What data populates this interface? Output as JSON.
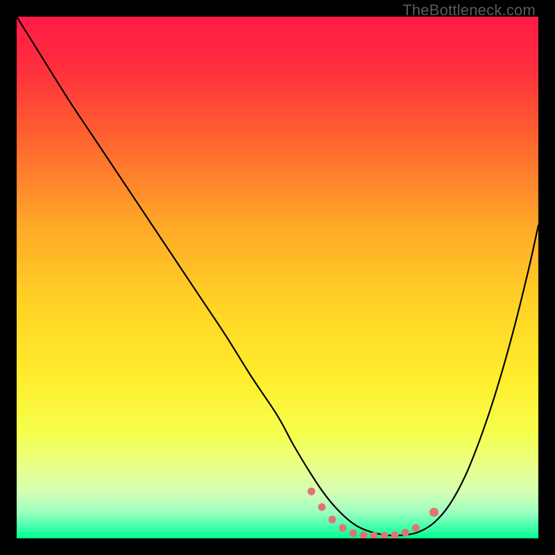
{
  "watermark": "TheBottleneck.com",
  "colors": {
    "frame_bg": "#000000",
    "curve": "#000000",
    "marker_fill": "#e17372",
    "marker_stroke": "#d85f5e"
  },
  "chart_data": {
    "type": "line",
    "title": "",
    "xlabel": "",
    "ylabel": "",
    "xlim": [
      0,
      100
    ],
    "ylim": [
      0,
      100
    ],
    "gradient_stops": [
      {
        "offset": 0.0,
        "color": "#ff1a47"
      },
      {
        "offset": 0.1,
        "color": "#ff2f3d"
      },
      {
        "offset": 0.25,
        "color": "#ff6a2f"
      },
      {
        "offset": 0.4,
        "color": "#ffa828"
      },
      {
        "offset": 0.55,
        "color": "#ffd325"
      },
      {
        "offset": 0.7,
        "color": "#ffee2e"
      },
      {
        "offset": 0.8,
        "color": "#f6ff4e"
      },
      {
        "offset": 0.86,
        "color": "#eaff88"
      },
      {
        "offset": 0.91,
        "color": "#d6ffb3"
      },
      {
        "offset": 0.95,
        "color": "#9cffc0"
      },
      {
        "offset": 0.975,
        "color": "#4dffad"
      },
      {
        "offset": 1.0,
        "color": "#00ff90"
      }
    ],
    "series": [
      {
        "name": "bottleneck-curve",
        "x": [
          0,
          5,
          10,
          15,
          20,
          25,
          30,
          35,
          40,
          45,
          50,
          53,
          56,
          59,
          62,
          65,
          68,
          71,
          74,
          77,
          80,
          83,
          86,
          89,
          92,
          95,
          98,
          100
        ],
        "y": [
          100,
          92,
          84,
          76.5,
          69,
          61.5,
          54,
          46.5,
          39,
          31,
          23.5,
          18,
          13,
          8.5,
          5,
          2.5,
          1.2,
          0.6,
          0.6,
          1.2,
          3,
          6.5,
          12,
          19.5,
          28.5,
          39,
          51,
          60
        ]
      }
    ],
    "markers": {
      "name": "bottom-cluster",
      "points": [
        {
          "x": 56.5,
          "y": 9.0,
          "r": 5.5
        },
        {
          "x": 58.5,
          "y": 6.0,
          "r": 5.5
        },
        {
          "x": 60.5,
          "y": 3.6,
          "r": 5.5
        },
        {
          "x": 62.5,
          "y": 2.0,
          "r": 5.5
        },
        {
          "x": 64.5,
          "y": 1.0,
          "r": 5.5
        },
        {
          "x": 66.5,
          "y": 0.6,
          "r": 5.5
        },
        {
          "x": 68.5,
          "y": 0.5,
          "r": 5.5
        },
        {
          "x": 70.5,
          "y": 0.5,
          "r": 5.5
        },
        {
          "x": 72.5,
          "y": 0.6,
          "r": 5.5
        },
        {
          "x": 74.5,
          "y": 1.1,
          "r": 5.5
        },
        {
          "x": 76.5,
          "y": 2.0,
          "r": 5.5
        },
        {
          "x": 80.0,
          "y": 5.0,
          "r": 6.5
        }
      ]
    }
  }
}
